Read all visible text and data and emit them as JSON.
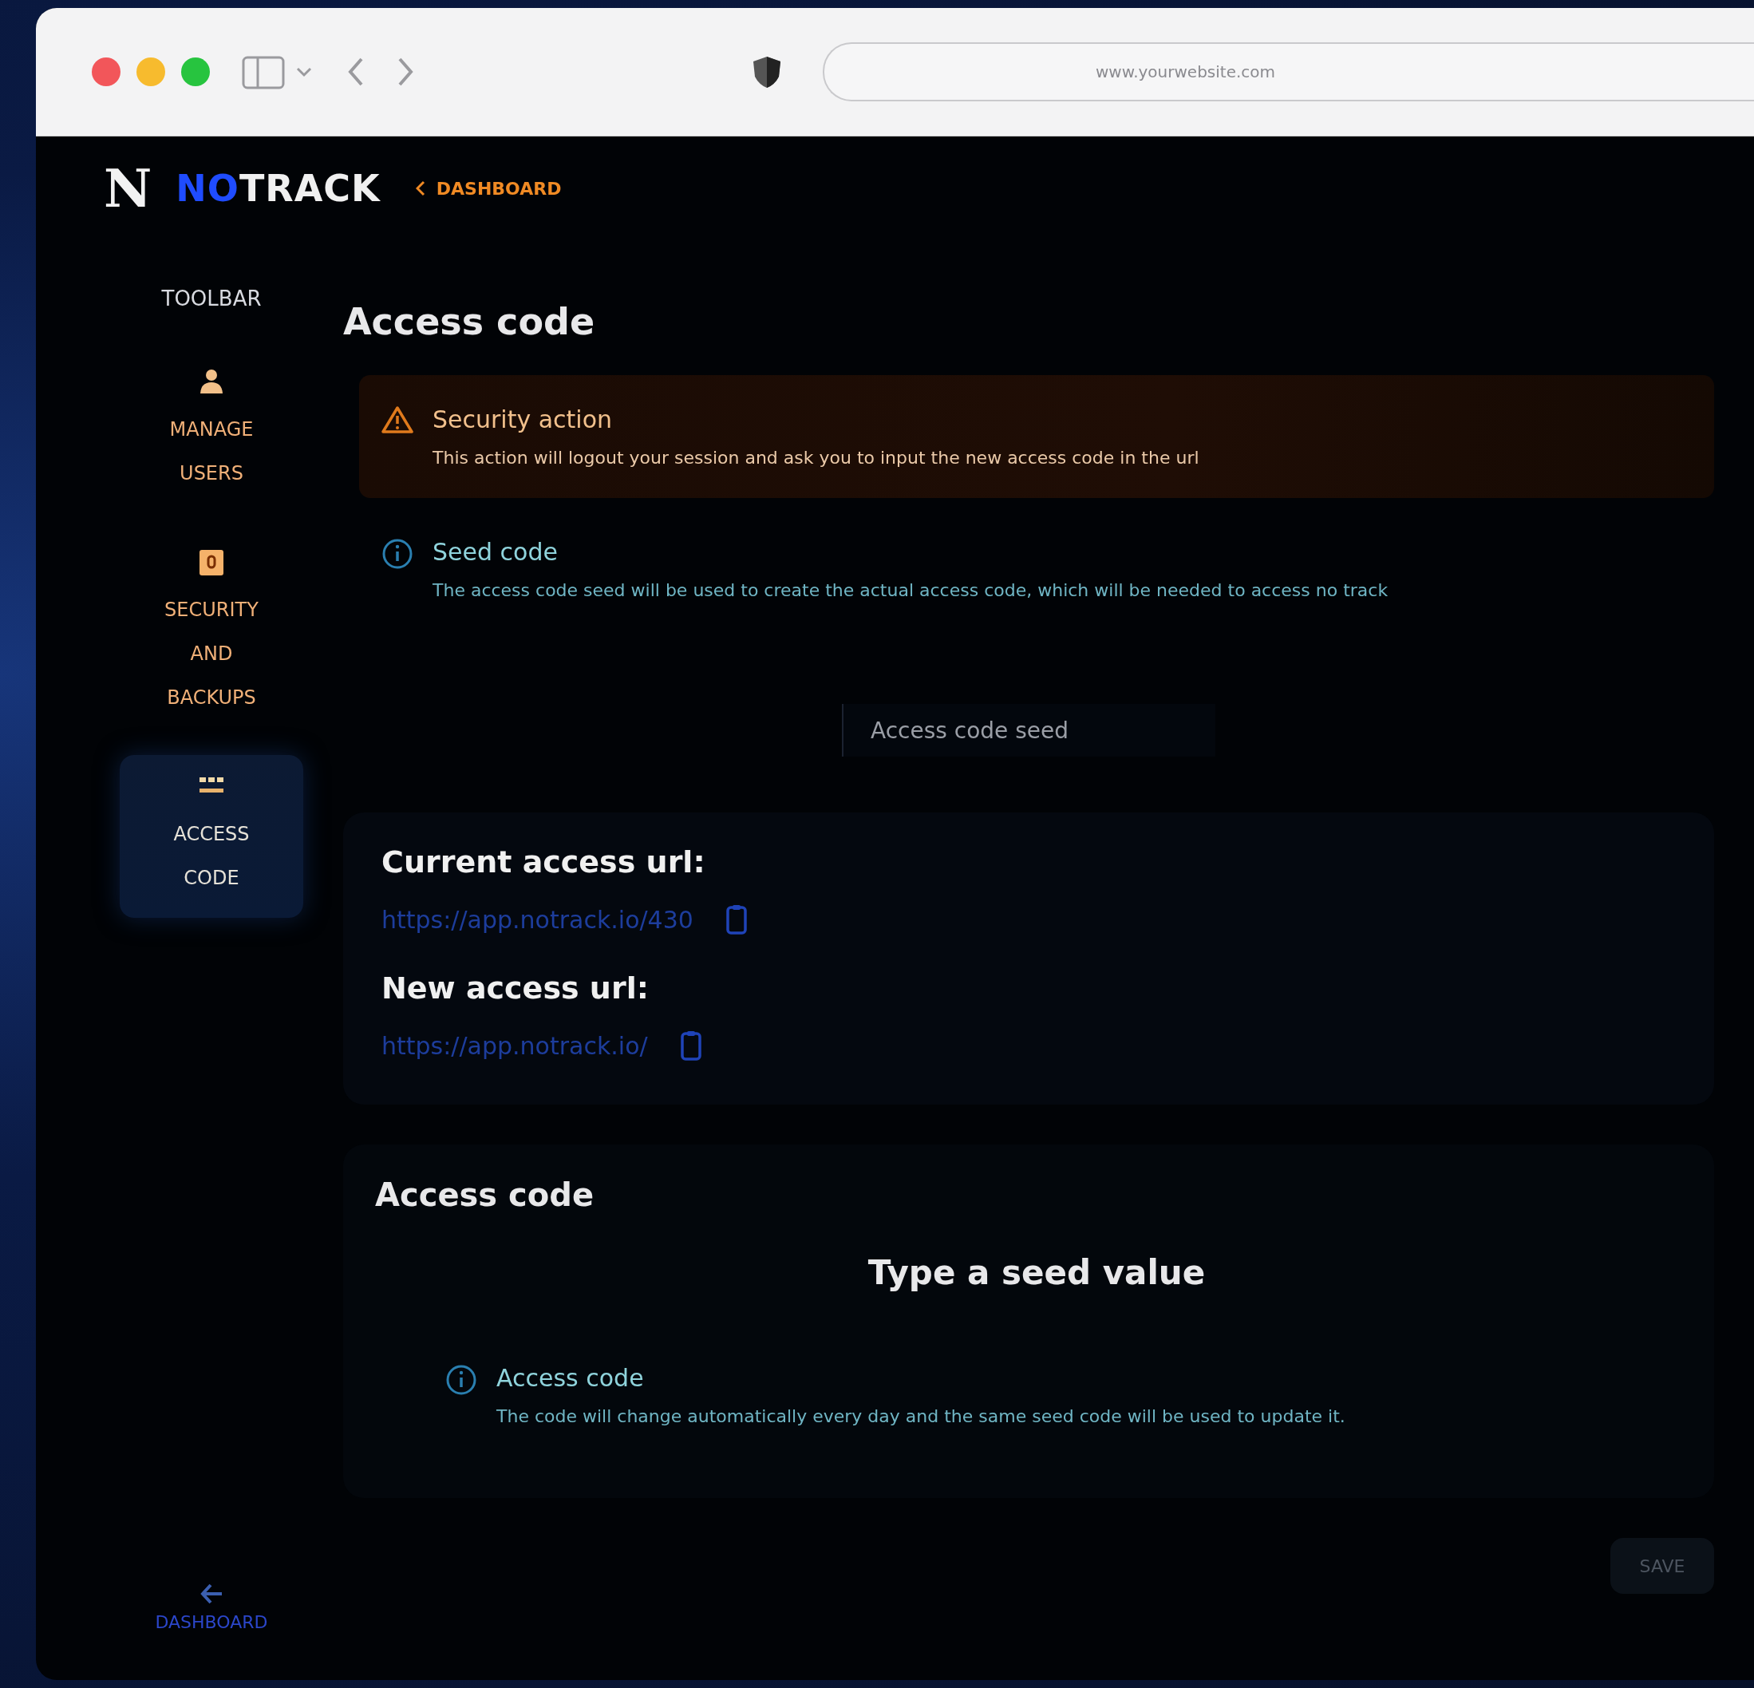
{
  "browser": {
    "address": "www.yourwebsite.com"
  },
  "app": {
    "logo_mark": "N",
    "brand_accent": "NO",
    "brand_rest": "TRACK",
    "back_link": "DASHBOARD"
  },
  "sidebar": {
    "heading": "TOOLBAR",
    "items": [
      {
        "label": "MANAGE USERS",
        "kind": "user",
        "selected": false
      },
      {
        "label": "SECURITY AND BACKUPS",
        "kind": "badge",
        "selected": false
      },
      {
        "label": "ACCESS CODE",
        "kind": "list",
        "selected": true
      }
    ],
    "footer_link": "DASHBOARD"
  },
  "page_title": "Access code",
  "alerts": [
    {
      "kind": "warning",
      "title": "Security action",
      "text": "This action will logout your session and ask you to input the new access code in the url"
    },
    {
      "kind": "info",
      "title": "Seed code",
      "text": "The access code seed will be used to create the actual access code, which will be needed to access no track"
    }
  ],
  "seed_field": {
    "placeholder": "Access code seed"
  },
  "urls": [
    {
      "label": "Current access url:",
      "value": "https://app.notrack.io/430"
    },
    {
      "label": "New access url:",
      "value": "https://app.notrack.io/"
    }
  ],
  "access_code": {
    "heading": "Access code",
    "prompt": "Type a seed value",
    "note": {
      "kind": "info",
      "title": "Access code",
      "text": "The code will change automatically every day and the same seed code will be used to update it."
    }
  },
  "save_button": "SAVE"
}
